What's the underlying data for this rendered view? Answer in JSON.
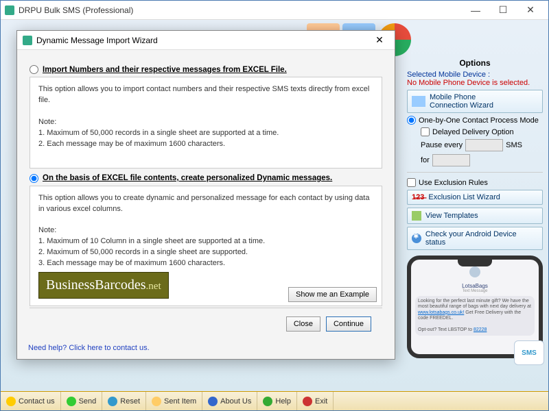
{
  "main_window": {
    "title": "DRPU Bulk SMS (Professional)"
  },
  "dialog": {
    "title": "Dynamic Message Import Wizard",
    "option1": {
      "label": "Import Numbers and their respective messages from EXCEL File.",
      "desc": "This option allows you to import contact numbers and their respective SMS texts directly from excel file.",
      "note_label": "Note:",
      "note1": "1. Maximum of 50,000 records in a single sheet are supported at a time.",
      "note2": "2. Each message may be of maximum 1600 characters."
    },
    "option2": {
      "label": "On the basis of EXCEL file contents, create personalized Dynamic messages.",
      "desc": "This option allows you to create dynamic and personalized message for each contact by using data in various excel columns.",
      "note_label": "Note:",
      "note1": "1. Maximum of 10 Column in a single sheet are supported at a time.",
      "note2": "2. Maximum of 50,000 records in a single sheet are supported.",
      "note3": "3. Each message may be of maximum 1600 characters."
    },
    "watermark_a": "BusinessBarcodes",
    "watermark_b": ".net",
    "example_btn": "Show me an Example",
    "close_btn": "Close",
    "continue_btn": "Continue",
    "help_link": "Need help? Click here to contact us."
  },
  "right": {
    "options_title": "Options",
    "selected_device_label": "Selected Mobile Device :",
    "no_device": "No Mobile Phone Device is selected.",
    "conn_wizard_1": "Mobile Phone",
    "conn_wizard_2": "Connection  Wizard",
    "mode": "One-by-One Contact Process Mode",
    "delayed": "Delayed Delivery Option",
    "pause_every": "Pause every",
    "sms": "SMS",
    "for": "for",
    "use_exclusion": "Use Exclusion Rules",
    "exclusion_btn": "Exclusion List Wizard",
    "templates_btn": "View Templates",
    "android_btn": "Check your Android Device status",
    "phone_sender": "LotsaBags",
    "phone_meta": "Text Message",
    "phone_msg": "Looking for the perfect last minute gift? We have the most beautiful range of bags with next day delivery at ",
    "phone_link1": "www.lotsabags.co.uk!",
    "phone_msg2": " Get Free Delivery with the code FREEDEL.",
    "phone_msg3": "Opt-out? Text LBSTOP to ",
    "phone_link2": "82228",
    "sms_badge": "SMS"
  },
  "bottom": {
    "contact": "Contact us",
    "send": "Send",
    "reset": "Reset",
    "sent_item": "Sent Item",
    "about": "About Us",
    "help": "Help",
    "exit": "Exit"
  }
}
